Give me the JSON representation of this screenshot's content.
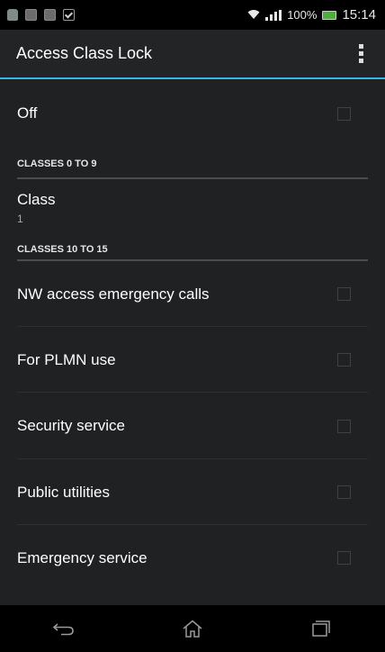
{
  "status_bar": {
    "icons_left": [
      "android-icon",
      "image-icon",
      "image-icon",
      "checkbox-icon"
    ],
    "battery_percent": "100%",
    "time": "15:14"
  },
  "action_bar": {
    "title": "Access Class Lock",
    "overflow_icon": "overflow-menu-icon",
    "accent_color": "#33b5e5"
  },
  "list": {
    "off": {
      "label": "Off",
      "checked": false
    },
    "section_0_9": "CLASSES 0 TO 9",
    "class_item": {
      "label": "Class",
      "summary": "1"
    },
    "section_10_15": "CLASSES 10 TO 15",
    "items": [
      {
        "label": "NW access emergency calls",
        "checked": false
      },
      {
        "label": "For PLMN use",
        "checked": false
      },
      {
        "label": "Security service",
        "checked": false
      },
      {
        "label": "Public utilities",
        "checked": false
      },
      {
        "label": "Emergency service",
        "checked": false
      }
    ]
  },
  "nav_bar": {
    "buttons": [
      "back-icon",
      "home-icon",
      "recents-icon"
    ]
  }
}
